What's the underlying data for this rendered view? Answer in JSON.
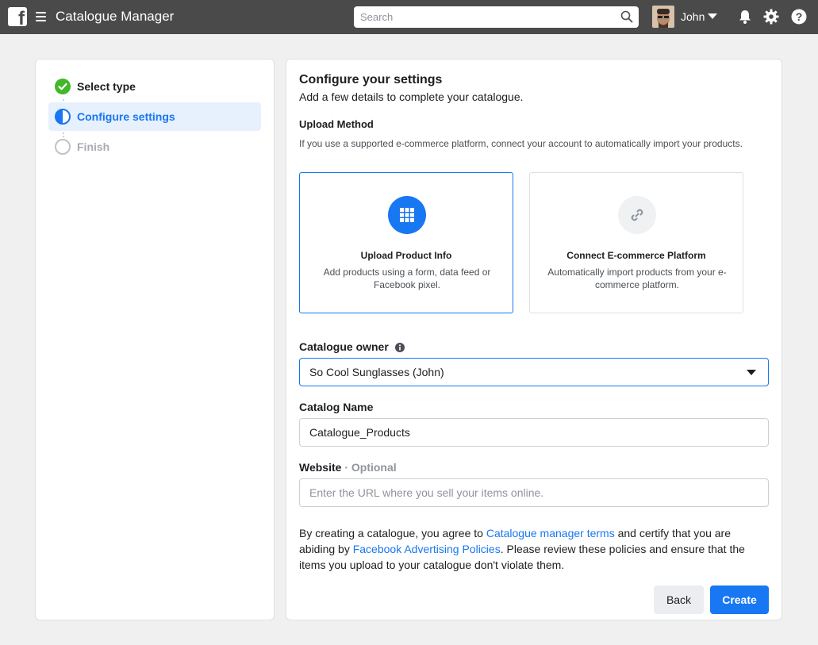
{
  "header": {
    "logo_letter": "f",
    "app_title": "Catalogue Manager",
    "search_placeholder": "Search",
    "user_name": "John",
    "icons": [
      "menu-icon",
      "search-icon",
      "bell-icon",
      "gear-icon",
      "help-icon"
    ]
  },
  "steps": [
    {
      "label": "Select type",
      "state": "complete"
    },
    {
      "label": "Configure settings",
      "state": "active"
    },
    {
      "label": "Finish",
      "state": "pending"
    }
  ],
  "main": {
    "title": "Configure your settings",
    "subtitle": "Add a few details to complete your catalogue.",
    "upload_method": {
      "label": "Upload Method",
      "description": "If you use a supported e-commerce platform, connect your account to automatically import your products.",
      "options": [
        {
          "title": "Upload Product Info",
          "description": "Add products using a form, data feed or Facebook pixel.",
          "icon": "grid-icon",
          "selected": true
        },
        {
          "title": "Connect E-commerce Platform",
          "description": "Automatically import products from your e-commerce platform.",
          "icon": "link-icon",
          "selected": false
        }
      ]
    },
    "catalogue_owner": {
      "label": "Catalogue owner",
      "value": "So Cool Sunglasses (John)"
    },
    "catalog_name": {
      "label": "Catalog Name",
      "value": "Catalogue_Products"
    },
    "website": {
      "label": "Website",
      "optional_label": "· Optional",
      "placeholder": "Enter the URL where you sell your items online."
    },
    "terms": {
      "part1": "By creating a catalogue, you agree to ",
      "link1": "Catalogue manager terms",
      "part2": " and certify that you are abiding by ",
      "link2": "Facebook Advertising Policies",
      "part3": ". Please review these policies and ensure that the items you upload to your catalogue don't violate them."
    },
    "buttons": {
      "back": "Back",
      "create": "Create"
    }
  },
  "colors": {
    "accent": "#1877f2",
    "success": "#42b72a",
    "topbar": "#4a4a4a"
  }
}
